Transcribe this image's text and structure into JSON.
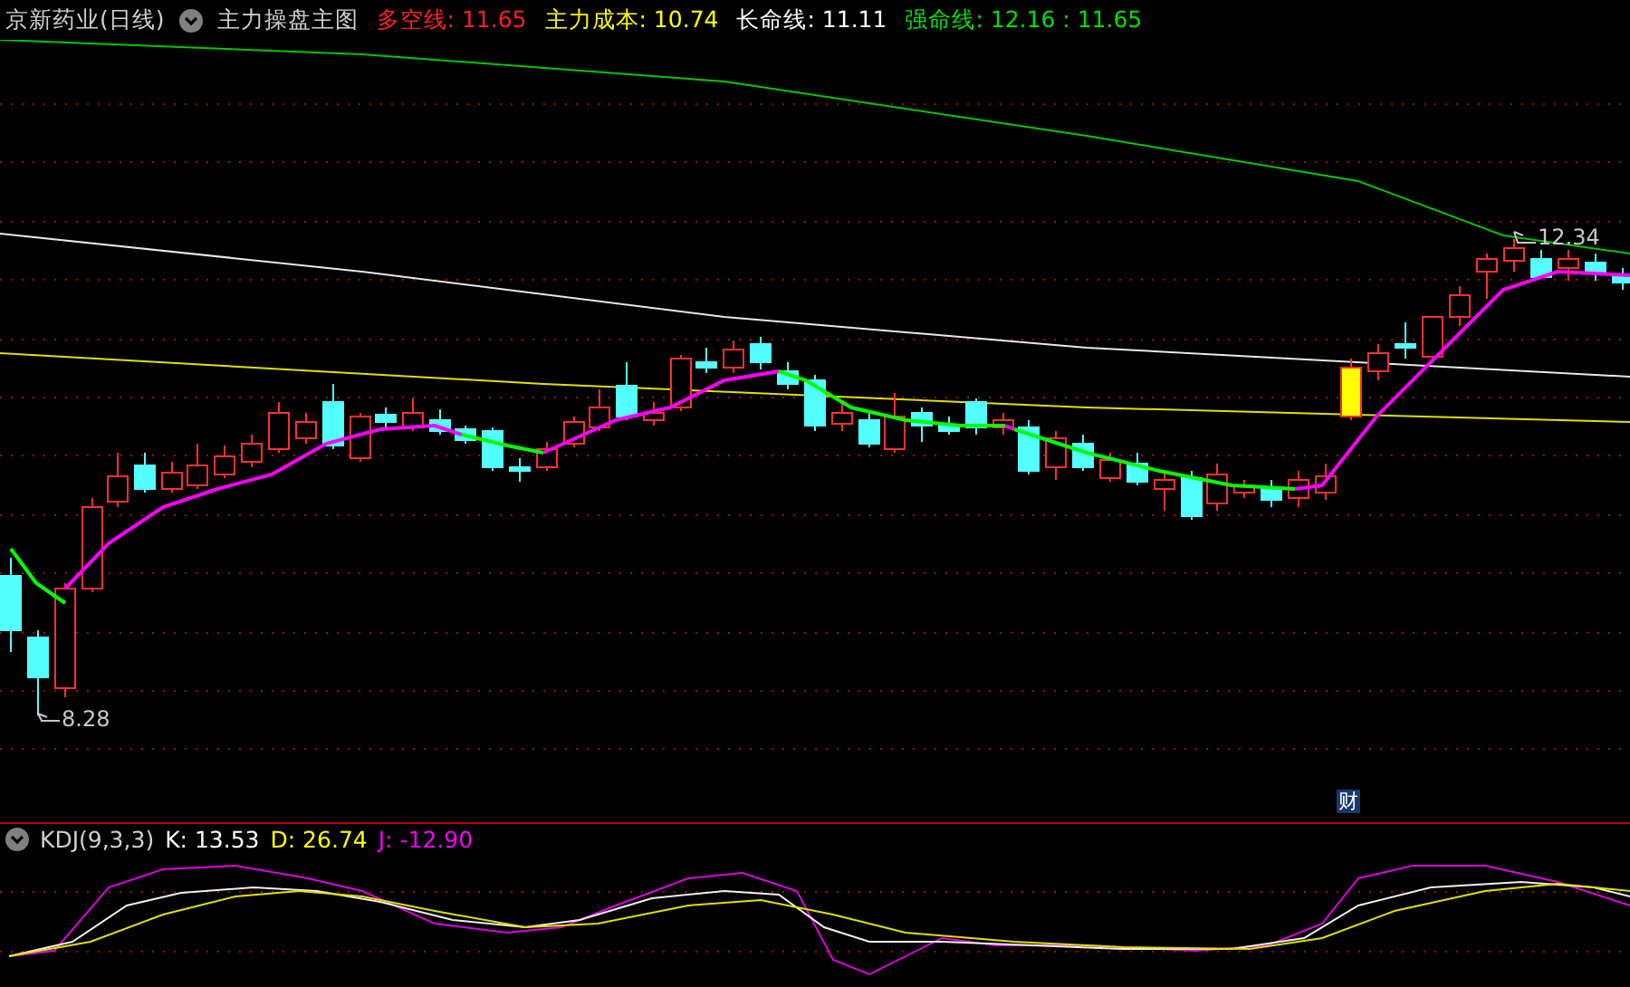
{
  "header": {
    "stock": "京新药业(日线)",
    "indicator": "主力操盘主图",
    "values": [
      {
        "label": "多空线:",
        "value": "11.65",
        "color": "#ff2020"
      },
      {
        "label": "主力成本:",
        "value": "10.74",
        "color": "#ffff00"
      },
      {
        "label": "长命线:",
        "value": "11.11",
        "color": "#ffffff"
      },
      {
        "label": "强命线:",
        "value": "12.16 : 11.65",
        "color": "#00e000"
      }
    ]
  },
  "price_chart": {
    "high_label": "12.34",
    "low_label": "8.28",
    "badge": "财"
  },
  "kdj": {
    "name": "KDJ(9,3,3)",
    "values": [
      {
        "label": "K:",
        "value": "13.53",
        "color": "#ffffff"
      },
      {
        "label": "D:",
        "value": "26.74",
        "color": "#ffff00"
      },
      {
        "label": "J:",
        "value": "-12.90",
        "color": "#ff00ff"
      }
    ]
  }
}
